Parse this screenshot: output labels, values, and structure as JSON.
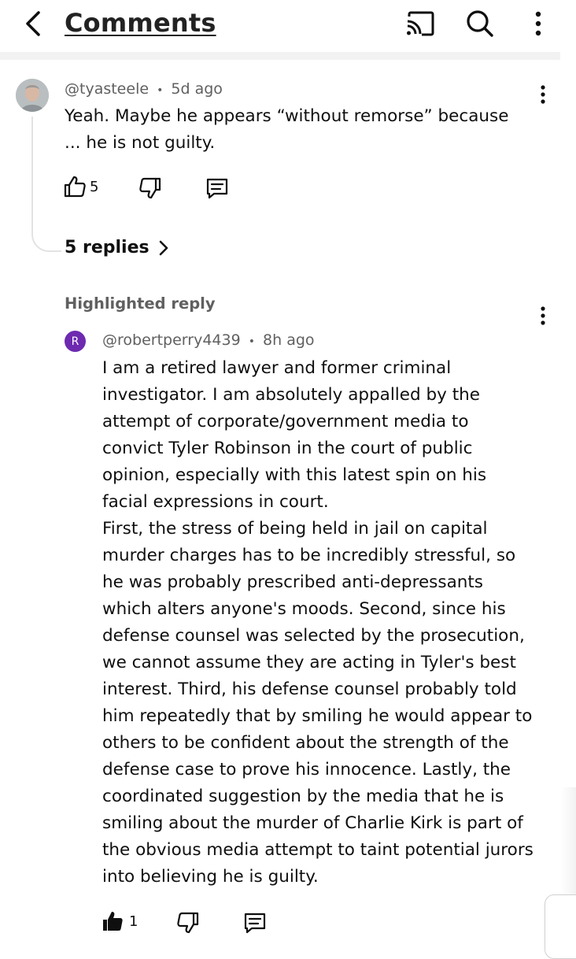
{
  "header": {
    "title": "Comments",
    "icons": [
      "back-arrow-icon",
      "cast-icon",
      "search-icon",
      "more-vert-icon"
    ]
  },
  "comment": {
    "author": "@tyasteele",
    "separator": "•",
    "time": "5d ago",
    "text_line1": "Yeah.  Maybe he appears “without remorse” because",
    "text_line2": "... he is not guilty.",
    "likes": "5",
    "replies_label": "5 replies"
  },
  "highlighted_reply": {
    "label": "Highlighted reply",
    "avatar_letter": "R",
    "avatar_color": "#6d2ab0",
    "author": "@robertperry4439",
    "separator": "•",
    "time": "8h ago",
    "lines": [
      "I am a retired lawyer and former criminal",
      "investigator.  I am absolutely appalled by the",
      "attempt of corporate/government media to",
      "convict Tyler Robinson in the court of public",
      "opinion, especially with this latest spin on his",
      "facial expressions in court.",
      "First, the stress of being held in jail on capital",
      "murder charges has to be incredibly stressful, so",
      "he was probably prescribed anti-depressants",
      "which alters anyone's moods.  Second, since his",
      "defense counsel was selected by the prosecution,",
      "we cannot assume they are acting in Tyler's best",
      "interest.  Third, his defense counsel probably told",
      "him repeatedly that by smiling he would appear to",
      "others to be confident about the strength of the",
      "defense case to prove his innocence.  Lastly, the",
      "coordinated suggestion by the media that he is",
      "smiling about the murder of Charlie Kirk is part of",
      "the obvious media attempt to taint potential jurors",
      "into believing he is guilty."
    ],
    "likes": "1"
  }
}
